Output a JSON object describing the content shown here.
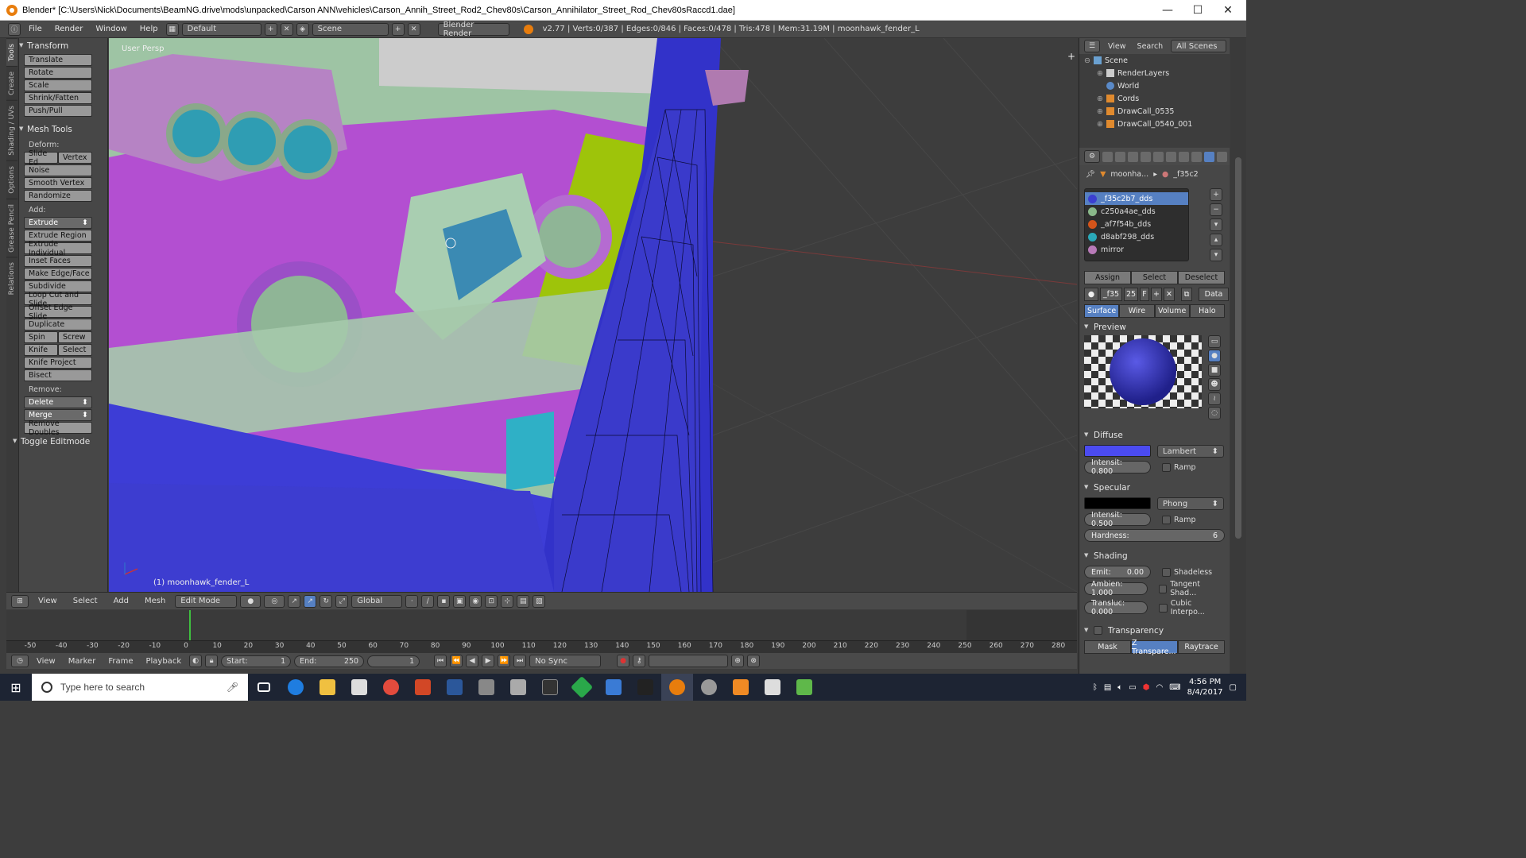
{
  "window": {
    "title": "Blender* [C:\\Users\\Nick\\Documents\\BeamNG.drive\\mods\\unpacked\\Carson ANN\\vehicles\\Carson_Annih_Street_Rod2_Chev80s\\Carson_Annihilator_Street_Rod_Chev80sRaccd1.dae]",
    "min": "—",
    "max": "☐",
    "close": "✕"
  },
  "info": {
    "menus": [
      "File",
      "Render",
      "Window",
      "Help"
    ],
    "layout": "Default",
    "scene": "Scene",
    "engine": "Blender Render",
    "stats": "v2.77 | Verts:0/387 | Edges:0/846 | Faces:0/478 | Tris:478 | Mem:31.19M | moonhawk_fender_L"
  },
  "tabs": [
    "Tools",
    "Create",
    "Shading / UVs",
    "Options",
    "Grease Pencil",
    "Relations"
  ],
  "tools": {
    "transform": "Transform",
    "transform_items": [
      "Translate",
      "Rotate",
      "Scale",
      "Shrink/Fatten",
      "Push/Pull"
    ],
    "mesh_tools": "Mesh Tools",
    "deform": "Deform:",
    "slide_edge": "Slide Ed",
    "vertex": "Vertex",
    "noise": "Noise",
    "smooth_vertex": "Smooth Vertex",
    "randomize": "Randomize",
    "add": "Add:",
    "extrude": "Extrude",
    "add_items": [
      "Extrude Region",
      "Extrude Individual",
      "Inset Faces",
      "Make Edge/Face",
      "Subdivide",
      "Loop Cut and Slide",
      "Offset Edge Slide",
      "Duplicate"
    ],
    "spin": "Spin",
    "screw": "Screw",
    "knife": "Knife",
    "select": "Select",
    "knife_project": "Knife Project",
    "bisect": "Bisect",
    "remove": "Remove:",
    "delete": "Delete",
    "merge": "Merge",
    "remove_doubles": "Remove Doubles",
    "toggle_editmode": "Toggle Editmode"
  },
  "viewport": {
    "view_name": "User Persp",
    "object_label": "(1) moonhawk_fender_L"
  },
  "vphead": {
    "view": "View",
    "select": "Select",
    "add": "Add",
    "mesh": "Mesh",
    "mode": "Edit Mode",
    "orientation": "Global"
  },
  "timeline": {
    "ticks": [
      "-50",
      "-40",
      "-30",
      "-20",
      "-10",
      "0",
      "10",
      "20",
      "30",
      "40",
      "50",
      "60",
      "70",
      "80",
      "90",
      "100",
      "110",
      "120",
      "130",
      "140",
      "150",
      "160",
      "170",
      "180",
      "190",
      "200",
      "210",
      "220",
      "230",
      "240",
      "250",
      "260",
      "270",
      "280"
    ],
    "view": "View",
    "marker": "Marker",
    "frame": "Frame",
    "playback": "Playback",
    "start_label": "Start:",
    "start": "1",
    "end_label": "End:",
    "end": "250",
    "current": "1",
    "sync": "No Sync"
  },
  "outliner": {
    "view": "View",
    "search": "Search",
    "scenes": "All Scenes",
    "items": [
      "Scene",
      "RenderLayers",
      "World",
      "Cords",
      "DrawCall_0535",
      "DrawCall_0540_001"
    ]
  },
  "props": {
    "breadcrumb_obj": "moonha...",
    "breadcrumb_mat": "_f35c2",
    "materials": [
      {
        "name": "_f35c2b7_dds",
        "color": "#3b3fd1"
      },
      {
        "name": "c250a4ae_dds",
        "color": "#8ab88a"
      },
      {
        "name": "_af7f54b_dds",
        "color": "#d4541a"
      },
      {
        "name": "d8abf298_dds",
        "color": "#2aa9b8"
      },
      {
        "name": "mirror",
        "color": "#b87ab8"
      }
    ],
    "assign": "Assign",
    "select": "Select",
    "deselect": "Deselect",
    "mat_short": "_f35",
    "users": "25",
    "fake": "F",
    "data": "Data",
    "surface": "Surface",
    "wire": "Wire",
    "volume": "Volume",
    "halo": "Halo",
    "preview": "Preview",
    "diffuse": "Diffuse",
    "diffuse_shader": "Lambert",
    "diffuse_intensity": "Intensit: 0.800",
    "ramp": "Ramp",
    "specular": "Specular",
    "specular_shader": "Phong",
    "specular_intensity": "Intensit: 0.500",
    "hardness_label": "Hardness:",
    "hardness": "6",
    "shading": "Shading",
    "emit": "Emit:",
    "emit_val": "0.00",
    "shadeless": "Shadeless",
    "ambient": "Ambien: 1.000",
    "tangent": "Tangent Shad...",
    "translucency": "Transluc: 0.000",
    "cubic": "Cubic Interpo...",
    "transparency": "Transparency",
    "mask": "Mask",
    "ztransp": "Z Transpare...",
    "raytrace": "Raytrace"
  },
  "taskbar": {
    "search": "Type here to search",
    "time": "4:56 PM",
    "date": "8/4/2017"
  }
}
